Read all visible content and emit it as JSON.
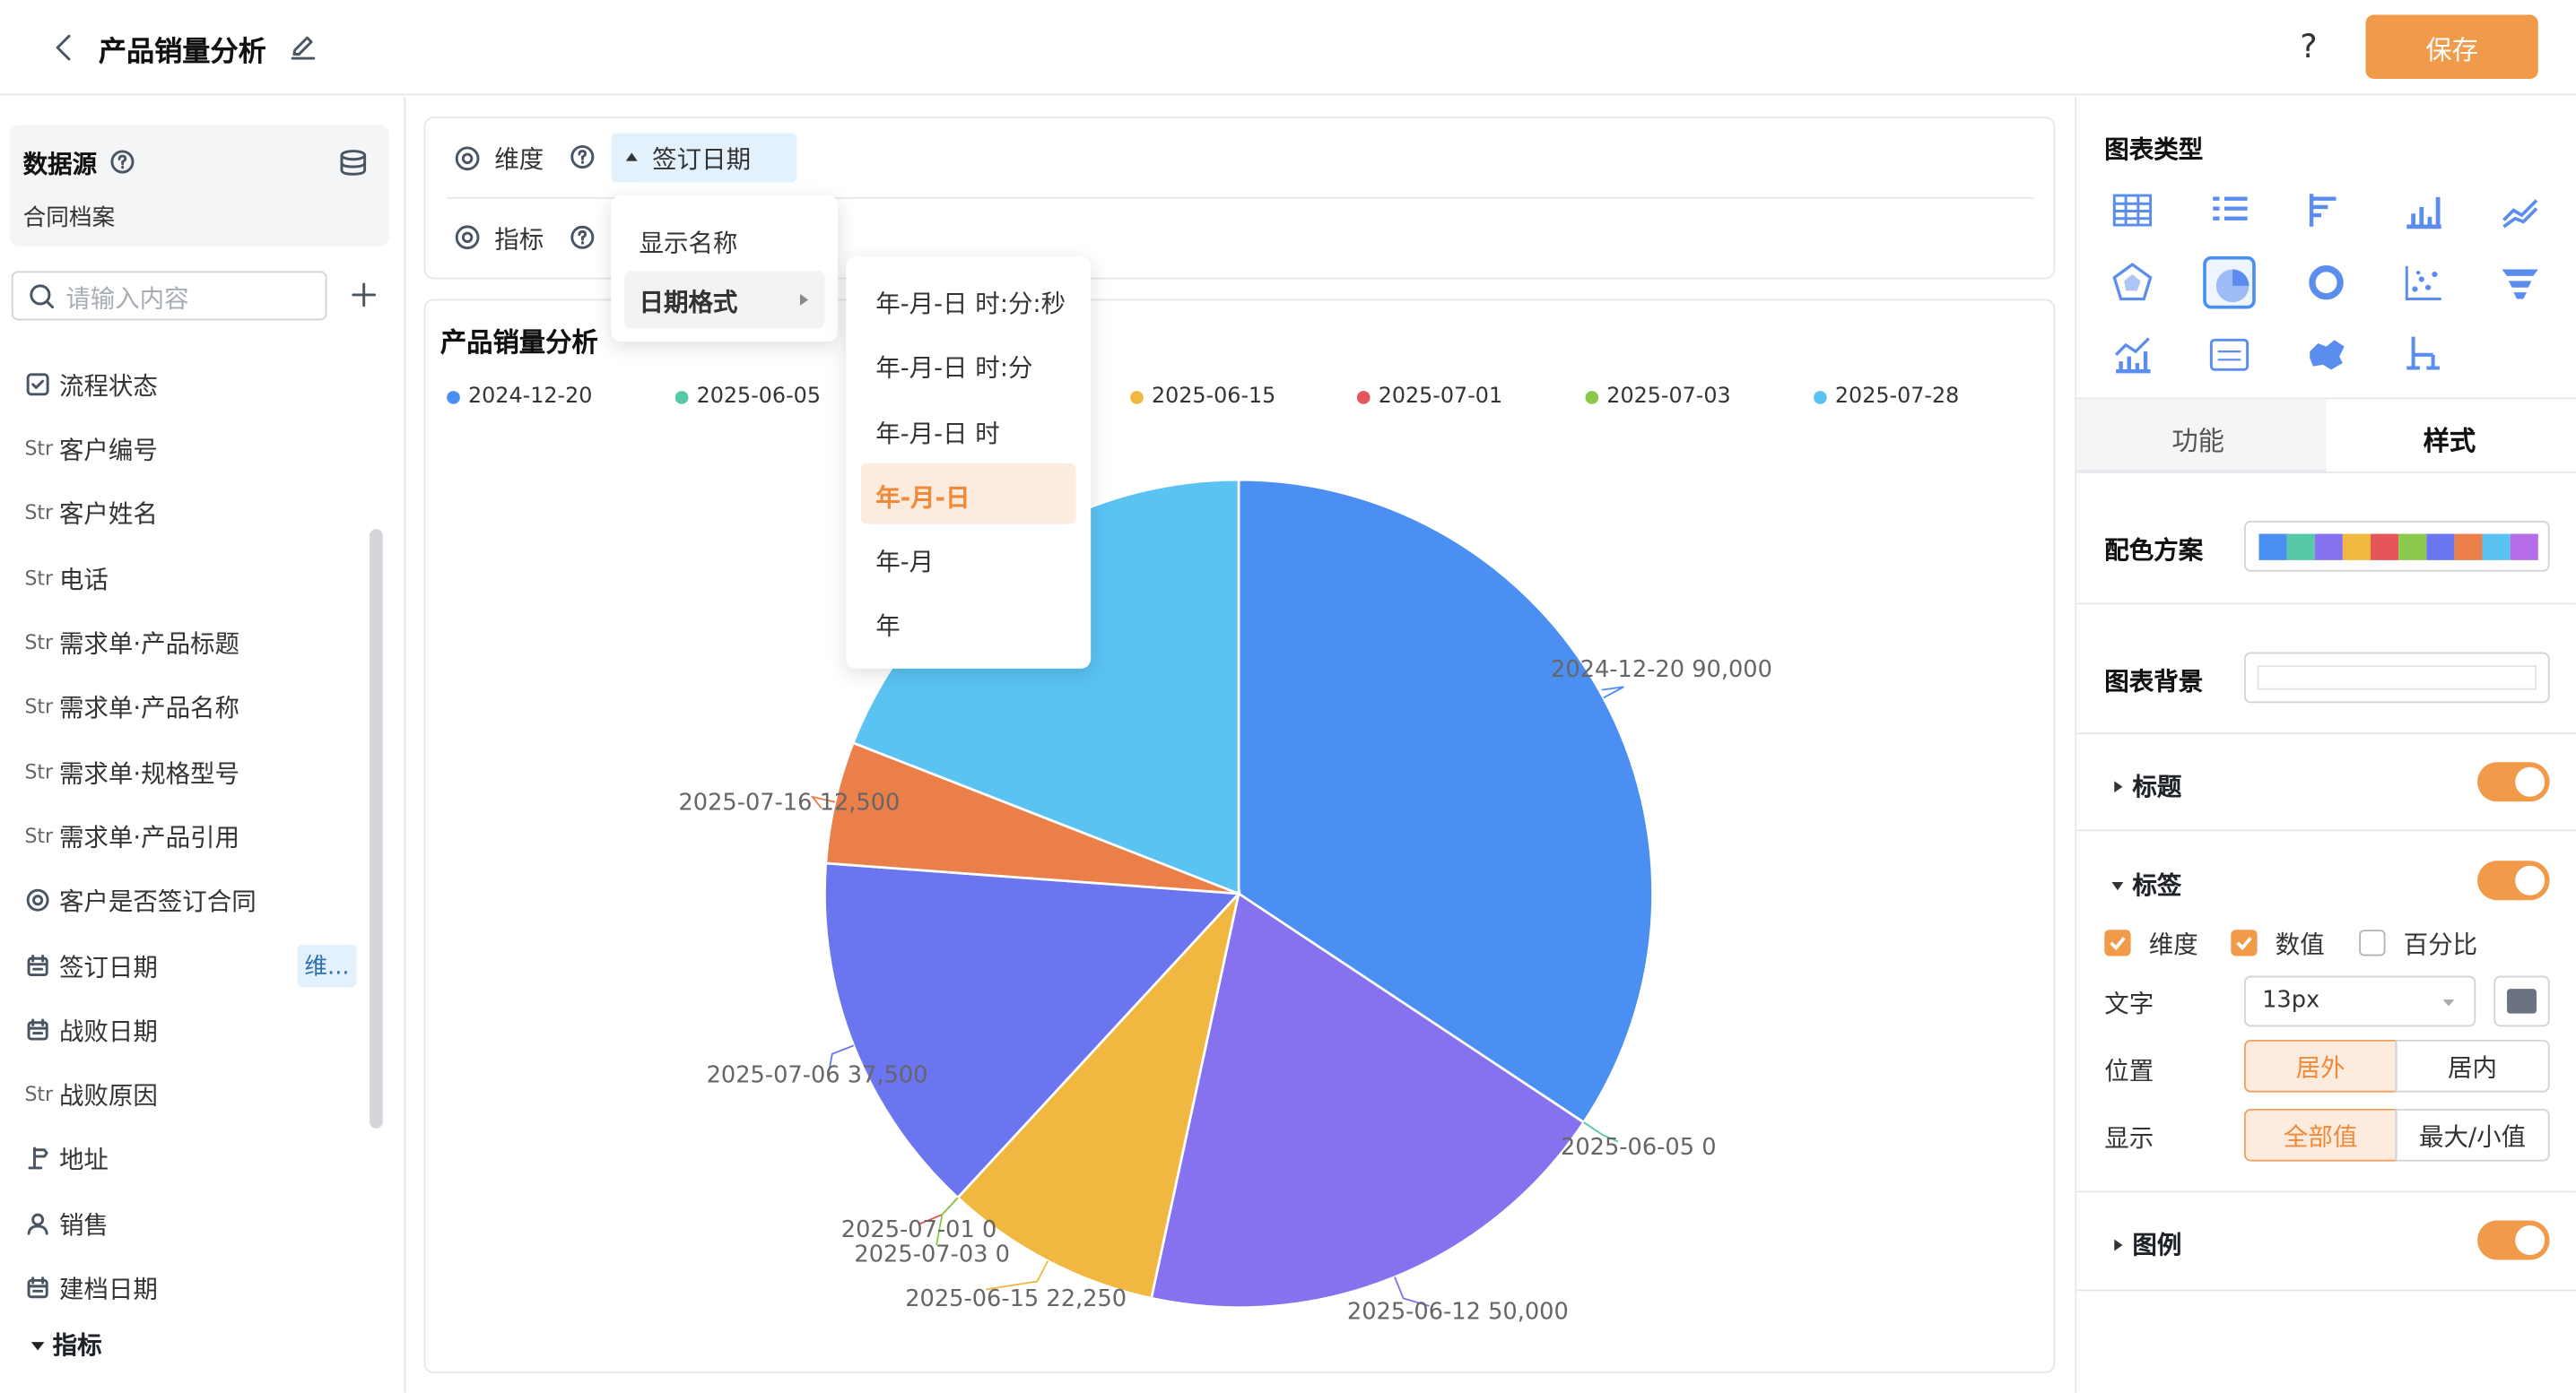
{
  "header": {
    "title": "产品销量分析",
    "help": "?",
    "save_label": "保存"
  },
  "datasource": {
    "label": "数据源",
    "name": "合同档案"
  },
  "search": {
    "placeholder": "请输入内容"
  },
  "fields": [
    {
      "prefix": "",
      "icon": "checkbox-icon",
      "label": "流程状态"
    },
    {
      "prefix": "Str",
      "icon": "",
      "label": "客户编号"
    },
    {
      "prefix": "Str",
      "icon": "",
      "label": "客户姓名"
    },
    {
      "prefix": "Str",
      "icon": "",
      "label": "电话"
    },
    {
      "prefix": "Str",
      "icon": "",
      "label": "需求单·产品标题"
    },
    {
      "prefix": "Str",
      "icon": "",
      "label": "需求单·产品名称"
    },
    {
      "prefix": "Str",
      "icon": "",
      "label": "需求单·规格型号"
    },
    {
      "prefix": "Str",
      "icon": "",
      "label": "需求单·产品引用"
    },
    {
      "prefix": "",
      "icon": "radio-icon",
      "label": "客户是否签订合同"
    },
    {
      "prefix": "",
      "icon": "calendar-icon",
      "label": "签订日期"
    },
    {
      "prefix": "",
      "icon": "calendar-icon",
      "label": "战败日期"
    },
    {
      "prefix": "Str",
      "icon": "",
      "label": "战败原因"
    },
    {
      "prefix": "",
      "icon": "location-icon",
      "label": "地址"
    },
    {
      "prefix": "",
      "icon": "user-icon",
      "label": "销售"
    },
    {
      "prefix": "",
      "icon": "calendar-icon",
      "label": "建档日期"
    }
  ],
  "dim_tag": "维...",
  "metrics_section": "指标",
  "config": {
    "dimension_label": "维度",
    "metric_label": "指标",
    "dimension_value": "签订日期"
  },
  "dim_menu": {
    "items": [
      "显示名称",
      "日期格式"
    ]
  },
  "date_format_menu": {
    "items": [
      "年-月-日 时:分:秒",
      "年-月-日 时:分",
      "年-月-日 时",
      "年-月-日",
      "年-月",
      "年"
    ],
    "selected": "年-月-日"
  },
  "chart_title": "产品销量分析",
  "chart_data": {
    "type": "pie",
    "title": "产品销量分析",
    "legend_position": "top",
    "legend": [
      "2024-12-20",
      "2025-06-05",
      "2025-06-15",
      "2025-07-01",
      "2025-07-03",
      "2025-07-28"
    ],
    "slices": [
      {
        "label": "2024-12-20",
        "value": 90000,
        "color": "#4b8ff2"
      },
      {
        "label": "2025-06-05",
        "value": 0,
        "color": "#56c9a6"
      },
      {
        "label": "2025-06-12",
        "value": 50000,
        "color": "#8672ee"
      },
      {
        "label": "2025-06-15",
        "value": 22250,
        "color": "#f0b840"
      },
      {
        "label": "2025-07-01",
        "value": 0,
        "color": "#e5555a"
      },
      {
        "label": "2025-07-03",
        "value": 0,
        "color": "#8cc84b"
      },
      {
        "label": "2025-07-06",
        "value": 37500,
        "color": "#6b75f0"
      },
      {
        "label": "2025-07-16",
        "value": 12500,
        "color": "#eb7f4a"
      },
      {
        "label": "2025-07-28",
        "value": 50000,
        "color": "#5ac3f2"
      }
    ],
    "data_labels": [
      "2024-12-20 90,000",
      "2025-06-05 0",
      "2025-06-12 50,000",
      "2025-06-15 22,250",
      "2025-07-01 0",
      "2025-07-03 0",
      "2025-07-06 37,500",
      "2025-07-16 12,500"
    ]
  },
  "right": {
    "chart_type_label": "图表类型",
    "tabs": [
      "功能",
      "样式"
    ],
    "color_scheme_label": "配色方案",
    "color_scheme": [
      "#4b8ff2",
      "#56c9a6",
      "#8672ee",
      "#f0b840",
      "#e5555a",
      "#8cc84b",
      "#6b75f0",
      "#eb7f4a",
      "#5ac3f2",
      "#b66ee8"
    ],
    "bg_label": "图表背景",
    "title_section": "标题",
    "label_section": "标签",
    "checks": [
      "维度",
      "数值",
      "百分比"
    ],
    "text_label": "文字",
    "font_size": "13px",
    "position_label": "位置",
    "position_options": [
      "居外",
      "居内"
    ],
    "display_label": "显示",
    "display_options": [
      "全部值",
      "最大/小值"
    ],
    "legend_section": "图例"
  }
}
